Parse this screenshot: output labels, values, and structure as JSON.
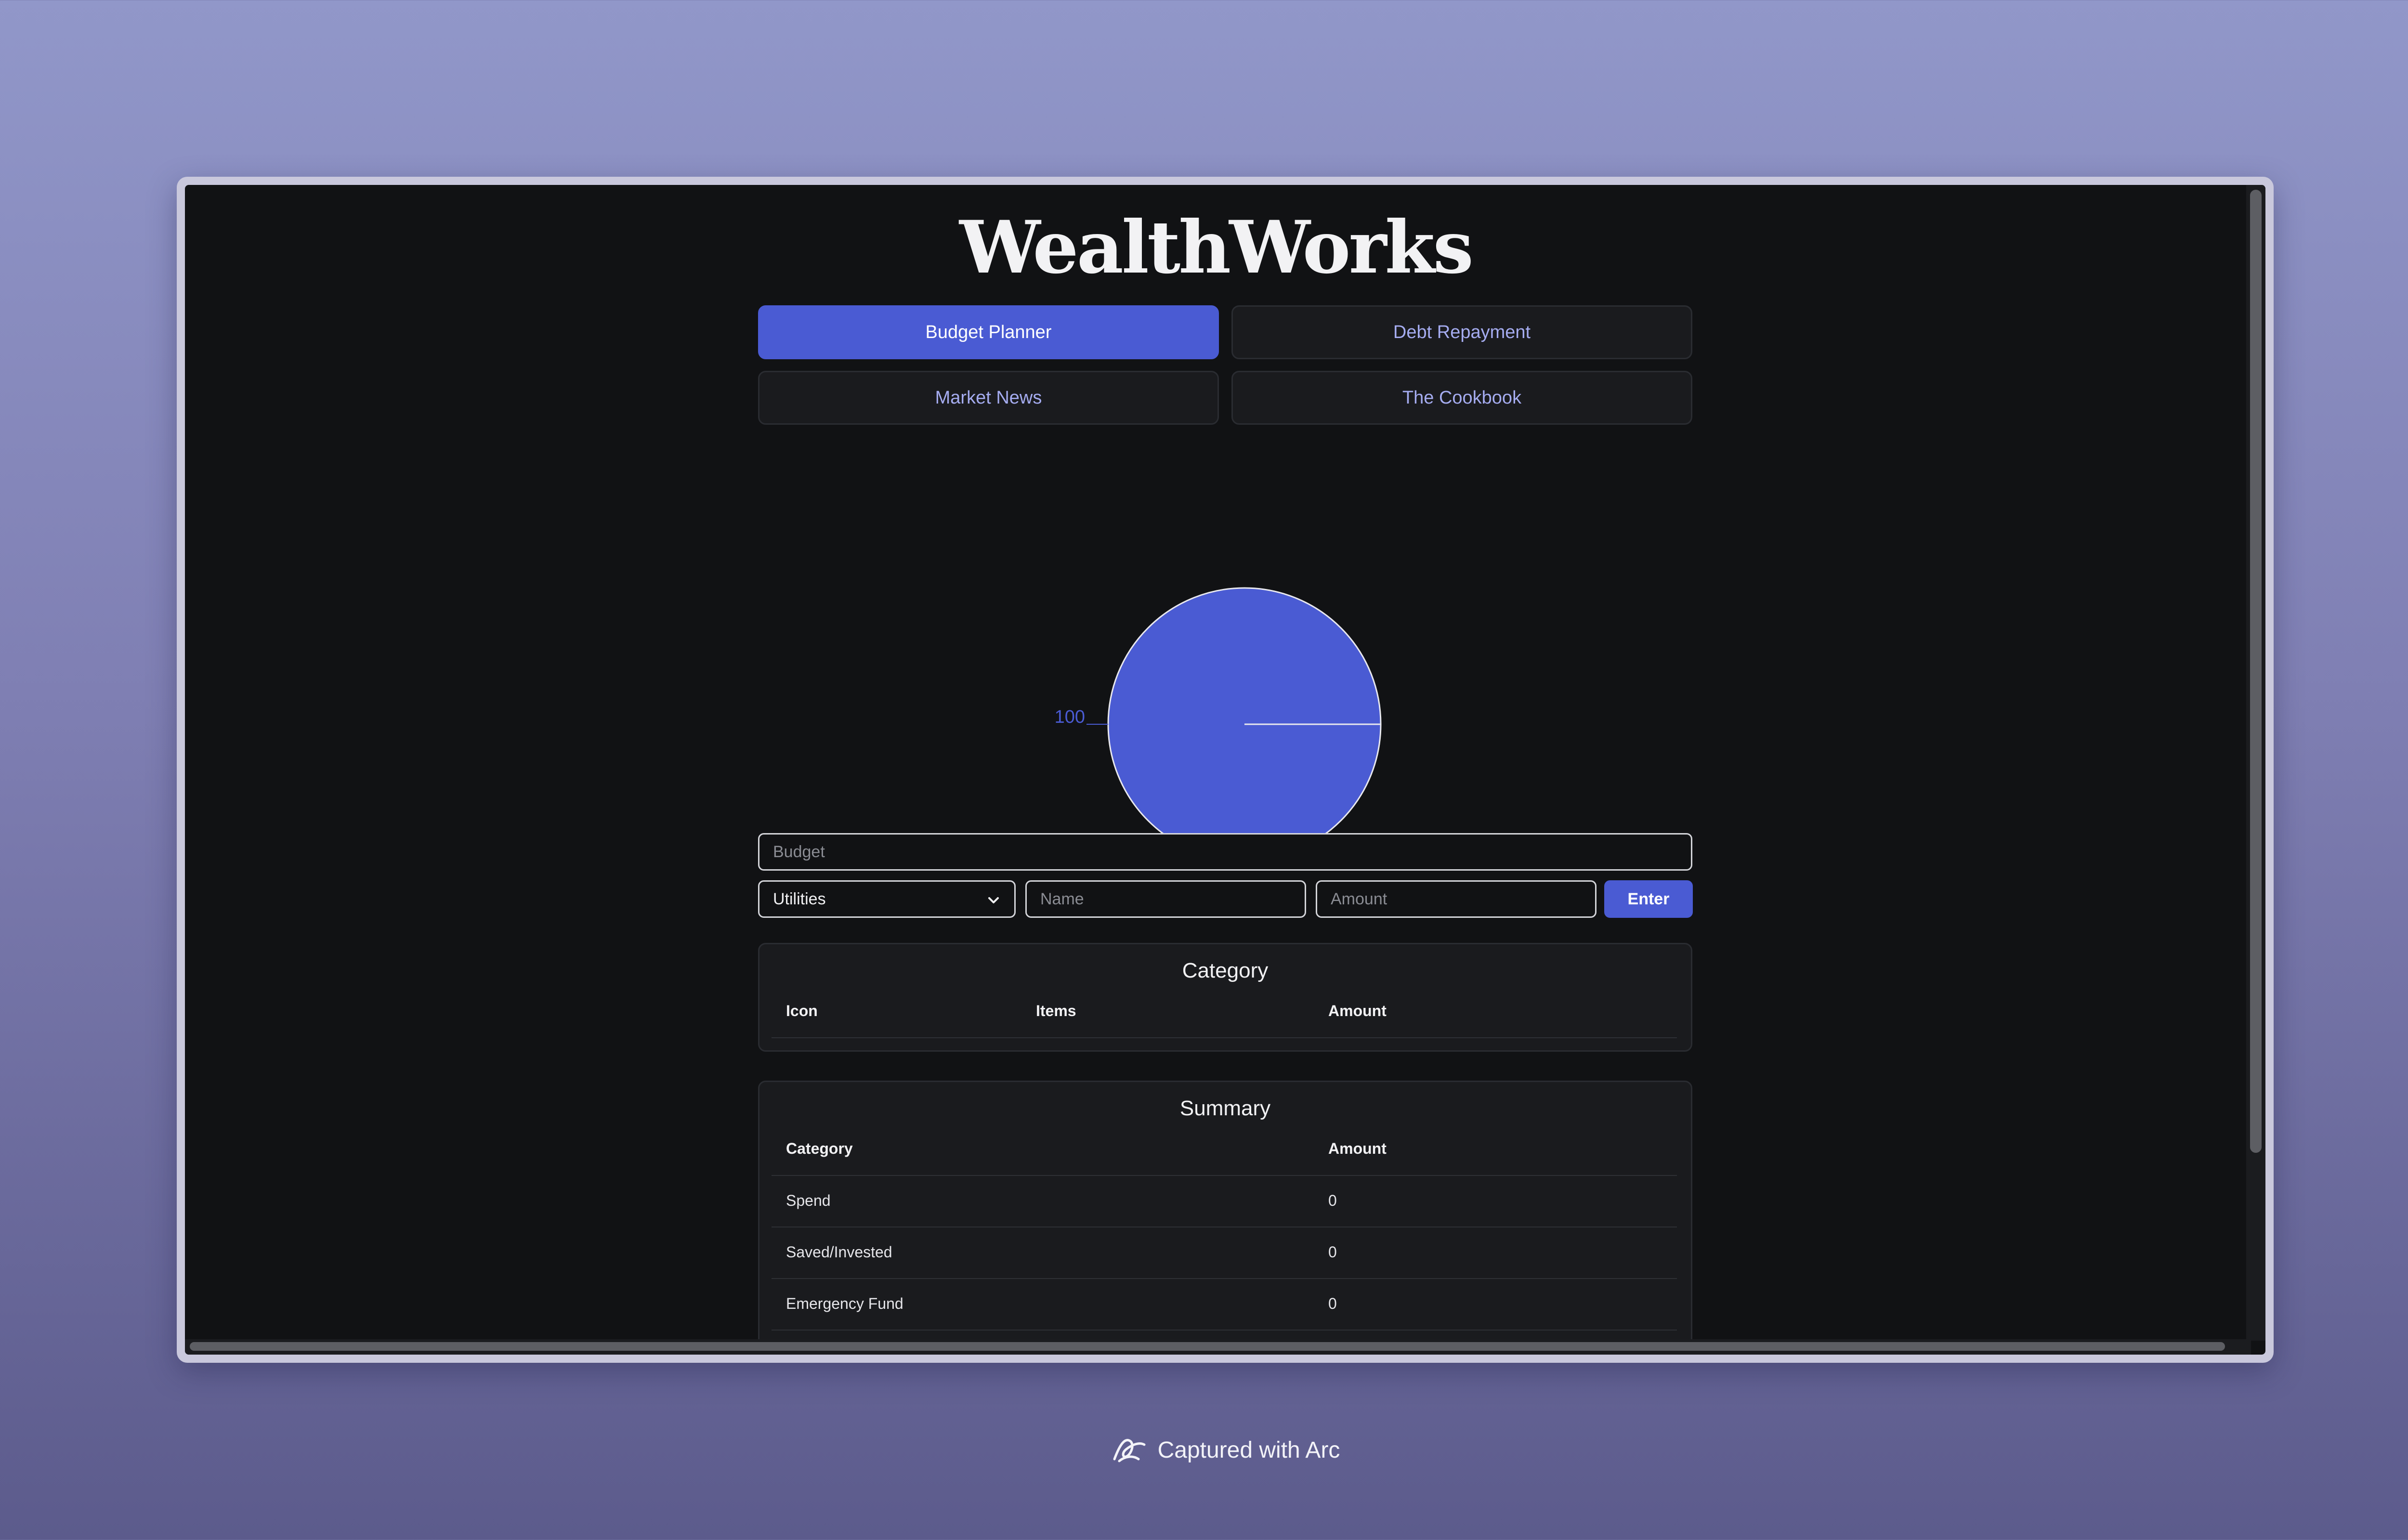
{
  "app": {
    "title": "WealthWorks"
  },
  "nav": {
    "items": [
      {
        "label": "Budget Planner",
        "active": true
      },
      {
        "label": "Debt Repayment",
        "active": false
      },
      {
        "label": "Market News",
        "active": false
      },
      {
        "label": "The Cookbook",
        "active": false
      }
    ]
  },
  "chart_data": {
    "type": "pie",
    "slices": [
      {
        "label": "100",
        "value": 100,
        "color": "#4a5bd3"
      }
    ],
    "title": "",
    "label_color": "#4a5bd3"
  },
  "form": {
    "budget_placeholder": "Budget",
    "category_selected": "Utilities",
    "name_placeholder": "Name",
    "amount_placeholder": "Amount",
    "enter_label": "Enter"
  },
  "category_table": {
    "title": "Category",
    "headers": [
      "Icon",
      "Items",
      "Amount"
    ]
  },
  "summary_table": {
    "title": "Summary",
    "headers": [
      "Category",
      "Amount"
    ],
    "rows": [
      {
        "category": "Spend",
        "amount": "0"
      },
      {
        "category": "Saved/Invested",
        "amount": "0"
      },
      {
        "category": "Emergency Fund",
        "amount": "0"
      }
    ]
  },
  "footer": {
    "caption": "Captured with Arc"
  },
  "colors": {
    "accent": "#4a5bd3",
    "background": "#111214",
    "card": "#1a1b1e"
  }
}
